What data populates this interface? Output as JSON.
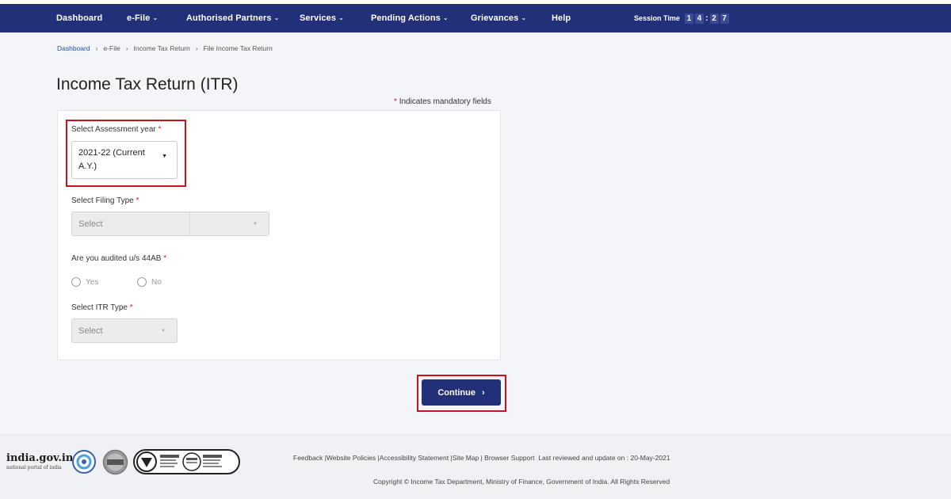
{
  "nav": {
    "items": [
      {
        "label": "Dashboard",
        "has_menu": false
      },
      {
        "label": "e-File",
        "has_menu": true
      },
      {
        "label": "Authorised Partners",
        "has_menu": true
      },
      {
        "label": "Services",
        "has_menu": true
      },
      {
        "label": "Pending Actions",
        "has_menu": true
      },
      {
        "label": "Grievances",
        "has_menu": true
      },
      {
        "label": "Help",
        "has_menu": false
      }
    ],
    "session_label": "Session Time",
    "session_digits": [
      "1",
      "4",
      "2",
      "7"
    ],
    "chevron_glyph": "⌄"
  },
  "breadcrumb": [
    "Dashboard",
    "e-File",
    "Income Tax Return",
    "File Income Tax Return"
  ],
  "page": {
    "title": "Income Tax Return (ITR)",
    "mandatory_note_asterisk": "*",
    "mandatory_note": "Indicates mandatory fields"
  },
  "form": {
    "assessment_year": {
      "label": "Select Assessment year",
      "value_line1": "2021-22  (Current",
      "value_line2": "A.Y.)"
    },
    "filing_type": {
      "label": "Select Filing Type",
      "placeholder": "Select"
    },
    "audited": {
      "label": "Are you audited u/s 44AB",
      "options": [
        "Yes",
        "No"
      ]
    },
    "itr_type": {
      "label": "Select ITR Type",
      "placeholder": "Select"
    },
    "required_mark": "*"
  },
  "actions": {
    "continue_label": "Continue",
    "continue_arrow": "›"
  },
  "footer": {
    "logo_main": "india.gov.in",
    "logo_sub": "national portal of india",
    "links": [
      "Feedback",
      "Website Policies",
      "Accessibility Statement",
      "Site Map",
      "Browser Support"
    ],
    "last_reviewed": "Last reviewed and update on : 20-May-2021",
    "copyright": "Copyright © Income Tax Department, Ministry of Finance, Government of India. All Rights Reserved",
    "badges": [
      "entrust",
      "ISO 27001",
      "ISO 9001"
    ]
  },
  "colors": {
    "nav_bg": "#22307a",
    "highlight": "#c3151c",
    "required": "#d0202a",
    "link": "#1d4eb6"
  }
}
